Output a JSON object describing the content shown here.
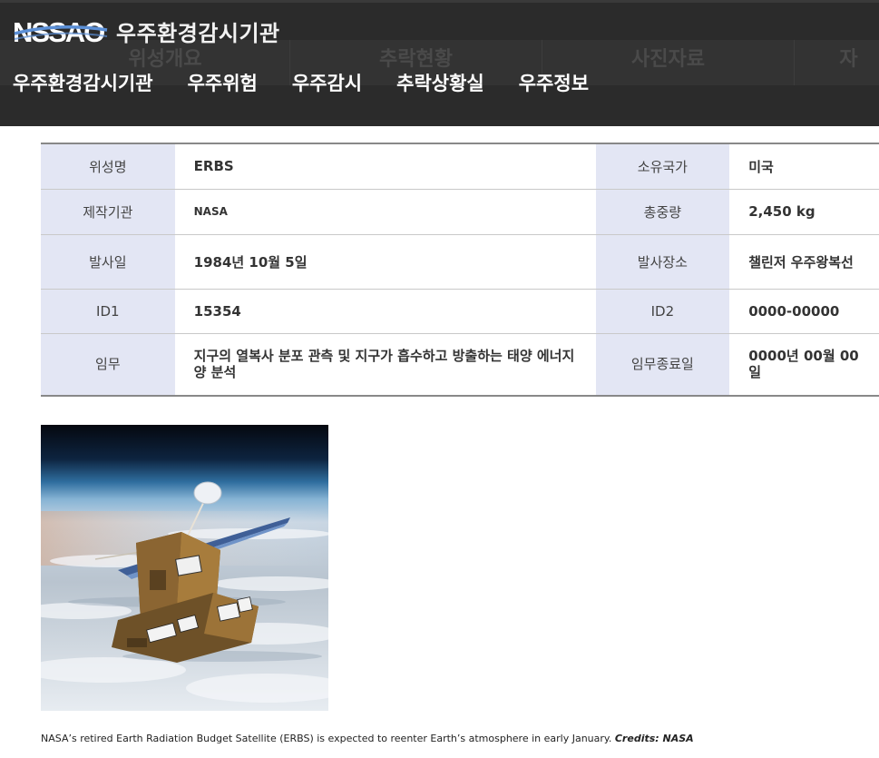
{
  "header": {
    "logo_text": "우주환경감시기관",
    "background_tabs": [
      "위성개요",
      "추락현황",
      "사진자료",
      "자"
    ],
    "nav": [
      "우주환경감시기관",
      "우주위험",
      "우주감시",
      "추락상황실",
      "우주정보"
    ]
  },
  "satellite": {
    "name_label": "위성명",
    "name_value": "ERBS",
    "country_label": "소유국가",
    "country_value": "미국",
    "maker_label": "제작기관",
    "maker_value": "NASA",
    "weight_label": "총중량",
    "weight_value": "2,450 kg",
    "launch_date_label": "발사일",
    "launch_date_value": "1984년 10월 5일",
    "launch_site_label": "발사장소",
    "launch_site_value": "챌린저 우주왕복선",
    "id1_label": "ID1",
    "id1_value": "15354",
    "id2_label": "ID2",
    "id2_value": "0000-00000",
    "mission_label": "임무",
    "mission_value": "지구의 열복사 분포 관측 및 지구가 흡수하고 방출하는 태양 에너지양 분석",
    "mission_end_label": "임무종료일",
    "mission_end_value": "0000년 00월 00일"
  },
  "photo": {
    "caption": "NASA’s retired Earth Radiation Budget Satellite (ERBS) is expected to reenter Earth’s atmosphere in early January.",
    "credit": "Credits: NASA"
  },
  "colors": {
    "header_bg": "#2b2b2b",
    "table_header_bg": "#e3e6f4",
    "logo_blue": "#5b8fd6"
  }
}
